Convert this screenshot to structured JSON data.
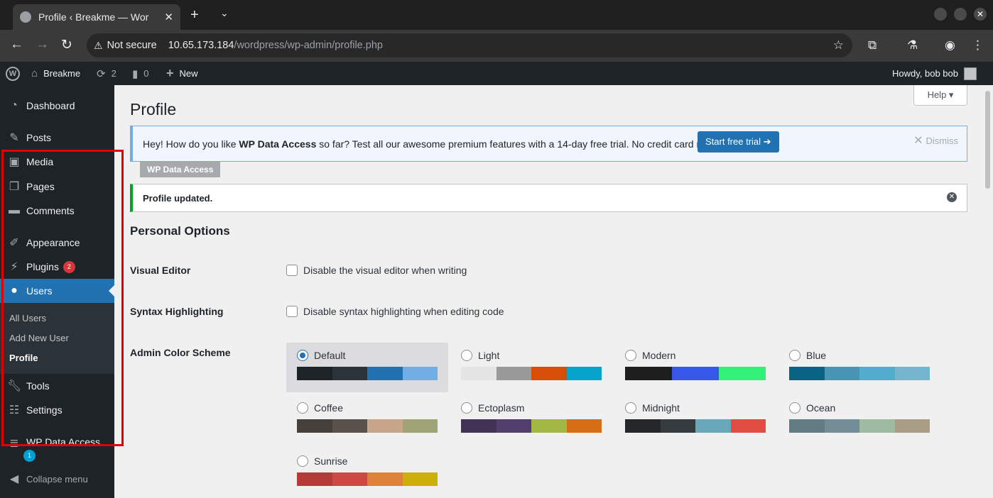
{
  "browser": {
    "tab_title": "Profile ‹ Breakme — Wor",
    "not_secure": "Not secure",
    "url_host": "10.65.173.184",
    "url_path": "/wordpress/wp-admin/profile.php"
  },
  "adminbar": {
    "site_name": "Breakme",
    "updates_count": "2",
    "comments_count": "0",
    "new_label": "New",
    "howdy": "Howdy, bob bob"
  },
  "sidebar": {
    "items": [
      {
        "label": "Dashboard",
        "icon": "dashboard-icon"
      },
      {
        "label": "Posts",
        "icon": "pin-icon"
      },
      {
        "label": "Media",
        "icon": "media-icon"
      },
      {
        "label": "Pages",
        "icon": "pages-icon"
      },
      {
        "label": "Comments",
        "icon": "comment-icon"
      },
      {
        "label": "Appearance",
        "icon": "brush-icon"
      },
      {
        "label": "Plugins",
        "icon": "plug-icon",
        "badge": "2"
      },
      {
        "label": "Users",
        "icon": "user-icon"
      },
      {
        "label": "Tools",
        "icon": "wrench-icon"
      },
      {
        "label": "Settings",
        "icon": "sliders-icon"
      },
      {
        "label": "WP Data Access",
        "icon": "database-icon",
        "badge": "1"
      }
    ],
    "submenu": [
      "All Users",
      "Add New User",
      "Profile"
    ],
    "collapse": "Collapse menu"
  },
  "main": {
    "help": "Help ▾",
    "title": "Profile",
    "notice_pre": "Hey! How do you like ",
    "notice_bold": "WP Data Access",
    "notice_post": " so far? Test all our awesome premium features with a 14-day free trial. No credit card required!",
    "trial_button": "Start free trial ➔",
    "dismiss": "Dismiss",
    "wpda_tag": "WP Data Access",
    "updated": "Profile updated.",
    "section": "Personal Options",
    "visual_editor_label": "Visual Editor",
    "visual_editor_text": "Disable the visual editor when writing",
    "syntax_label": "Syntax Highlighting",
    "syntax_text": "Disable syntax highlighting when editing code",
    "scheme_label": "Admin Color Scheme",
    "schemes": [
      {
        "name": "Default",
        "selected": true,
        "colors": [
          "#1d2327",
          "#2c3338",
          "#2271b1",
          "#72aee6"
        ]
      },
      {
        "name": "Light",
        "selected": false,
        "colors": [
          "#e5e5e5",
          "#999999",
          "#d64e07",
          "#04a4cc"
        ]
      },
      {
        "name": "Modern",
        "selected": false,
        "colors": [
          "#1e1e1e",
          "#3858e9",
          "#33f078"
        ]
      },
      {
        "name": "Blue",
        "selected": false,
        "colors": [
          "#096484",
          "#4796b3",
          "#52accc",
          "#74b6ce"
        ]
      },
      {
        "name": "Coffee",
        "selected": false,
        "colors": [
          "#46403c",
          "#59524c",
          "#c7a589",
          "#9ea476"
        ]
      },
      {
        "name": "Ectoplasm",
        "selected": false,
        "colors": [
          "#413256",
          "#523f6d",
          "#a3b745",
          "#d46f15"
        ]
      },
      {
        "name": "Midnight",
        "selected": false,
        "colors": [
          "#25282b",
          "#363b3f",
          "#69a8bb",
          "#e14d43"
        ]
      },
      {
        "name": "Ocean",
        "selected": false,
        "colors": [
          "#627c83",
          "#738e96",
          "#9ebaa0",
          "#aa9d88"
        ]
      },
      {
        "name": "Sunrise",
        "selected": false,
        "colors": [
          "#b43c38",
          "#cf4944",
          "#dd823b",
          "#ccaf0b"
        ]
      }
    ]
  }
}
